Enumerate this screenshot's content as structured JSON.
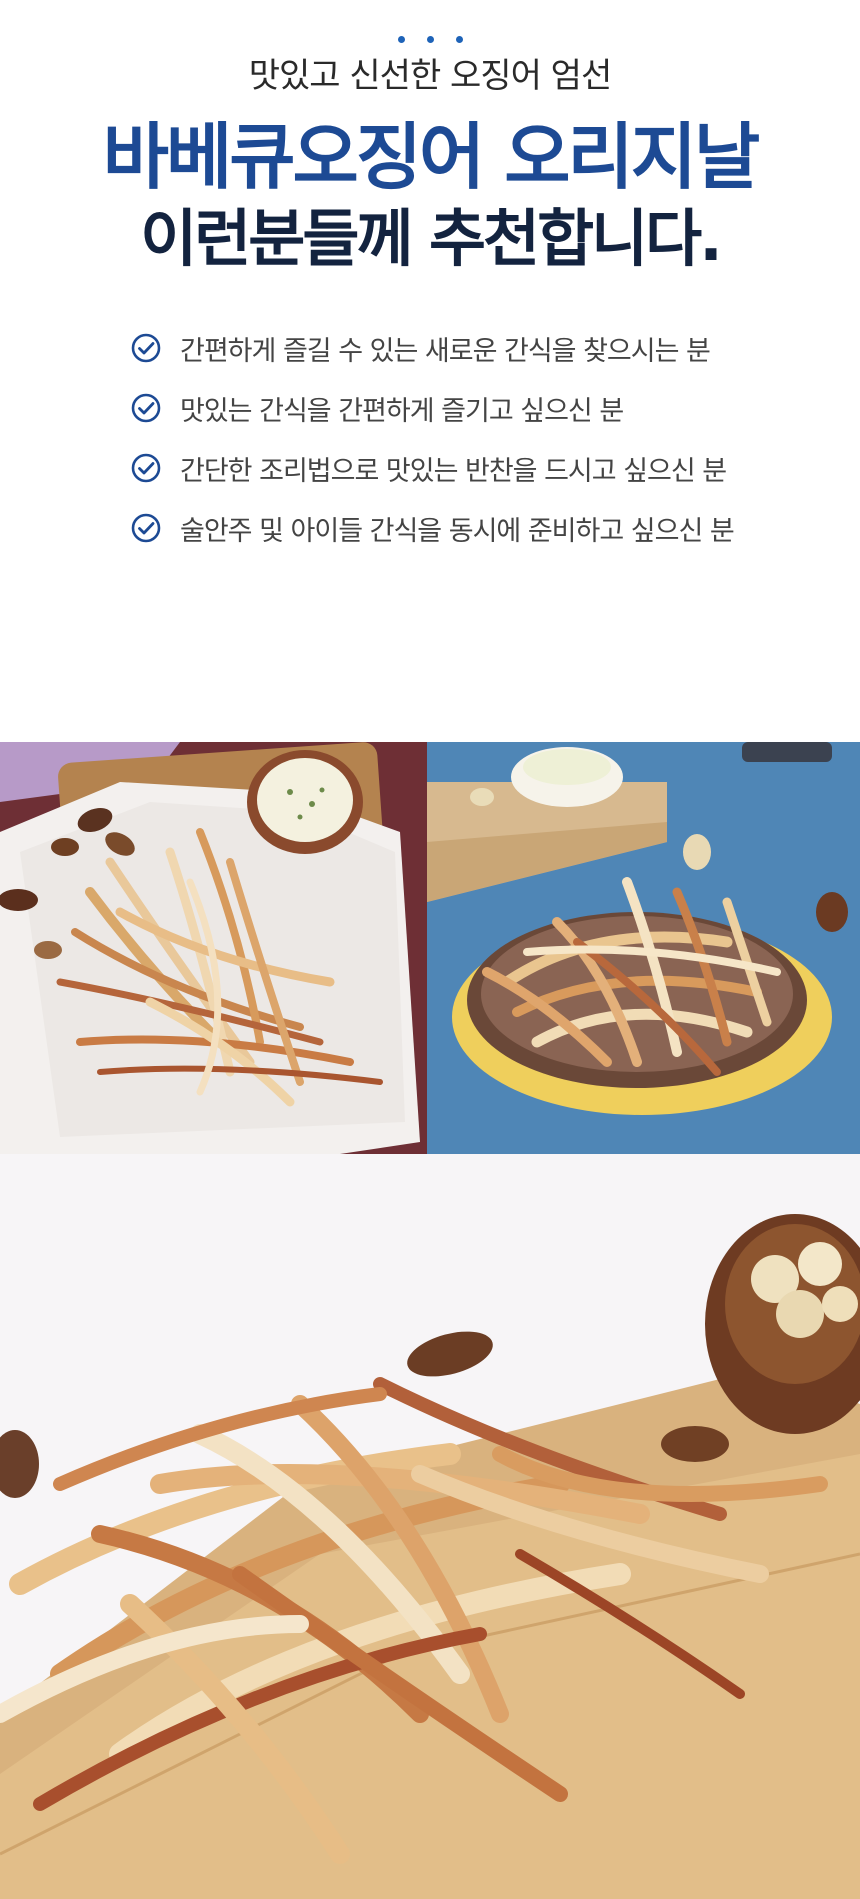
{
  "header": {
    "subtitle": "맛있고 신선한 오징어 엄선",
    "title_line1": "바베큐오징어 오리지날",
    "title_line2": "이런분들께 추천합니다.",
    "accent_color": "#1d4a94"
  },
  "recommendations": [
    {
      "icon": "check-circle-icon",
      "text": "간편하게 즐길 수 있는 새로운 간식을 찾으시는 분"
    },
    {
      "icon": "check-circle-icon",
      "text": "맛있는 간식을 간편하게 즐기고 싶으신 분"
    },
    {
      "icon": "check-circle-icon",
      "text": "간단한 조리법으로 맛있는 반찬을 드시고 싶으신 분"
    },
    {
      "icon": "check-circle-icon",
      "text": "술안주 및 아이들 간식을 동시에 준비하고 싶으신 분"
    }
  ],
  "photos": [
    {
      "subject": "squid strips on parchment with nuts and dip"
    },
    {
      "subject": "squid strips on a plate on blue background"
    },
    {
      "subject": "close-up of squid strips on wooden board with nuts"
    }
  ]
}
